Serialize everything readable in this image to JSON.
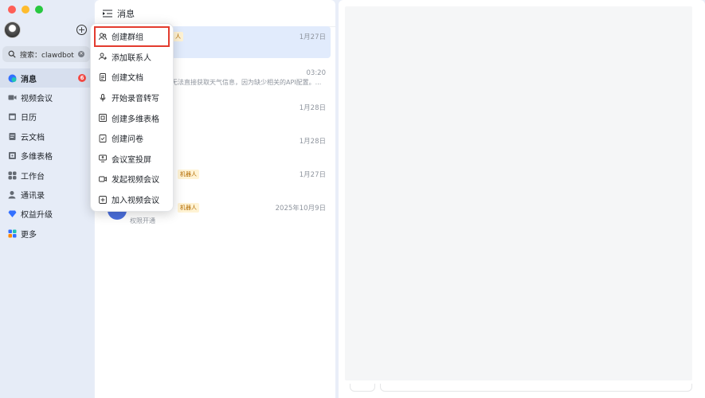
{
  "sidebar": {
    "search": {
      "placeholder": "搜索：clawdbot"
    },
    "items": [
      {
        "label": "消息",
        "icon": "message-bubble-icon",
        "badge": "6"
      },
      {
        "label": "视频会议",
        "icon": "video-camera-icon"
      },
      {
        "label": "日历",
        "icon": "calendar-icon"
      },
      {
        "label": "云文档",
        "icon": "cloud-doc-icon"
      },
      {
        "label": "多维表格",
        "icon": "table-grid-icon"
      },
      {
        "label": "工作台",
        "icon": "workspace-apps-icon"
      },
      {
        "label": "通讯录",
        "icon": "contacts-icon"
      },
      {
        "label": "权益升级",
        "icon": "diamond-icon"
      },
      {
        "label": "更多",
        "icon": "more-apps-icon"
      }
    ]
  },
  "list": {
    "title": "消息",
    "conversations": [
      {
        "time": "1月27日",
        "tag": "人",
        "preview": ""
      },
      {
        "time": "03:20",
        "tag": "",
        "preview": "无法直接获取天气信息，因为缺少相关的API配置。..."
      },
      {
        "time": "1月28日",
        "tag": "",
        "preview": ""
      },
      {
        "time": "1月28日",
        "tag": "",
        "preview": ""
      },
      {
        "time": "1月27日",
        "tag": "机器人",
        "preview": ""
      },
      {
        "time": "2025年10月9日",
        "tag": "机器人",
        "preview": "权限开通"
      }
    ]
  },
  "menu": {
    "items": [
      {
        "label": "创建群组",
        "icon": "group-icon"
      },
      {
        "label": "添加联系人",
        "icon": "add-contact-icon"
      },
      {
        "label": "创建文档",
        "icon": "document-icon"
      },
      {
        "label": "开始录音转写",
        "icon": "microphone-icon"
      },
      {
        "label": "创建多维表格",
        "icon": "table-grid-icon"
      },
      {
        "label": "创建问卷",
        "icon": "survey-icon"
      },
      {
        "label": "会议室投屏",
        "icon": "screen-cast-icon"
      },
      {
        "label": "发起视频会议",
        "icon": "video-camera-icon"
      },
      {
        "label": "加入视频会议",
        "icon": "join-meeting-icon"
      }
    ]
  },
  "colors": {
    "highlight_outline": "#e33b2e",
    "badge": "#f54a45",
    "selected_row": "#e1ebfc"
  }
}
